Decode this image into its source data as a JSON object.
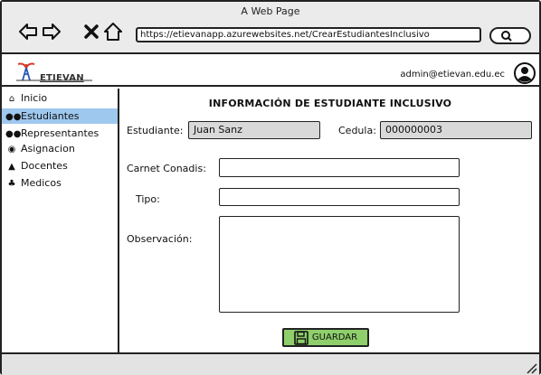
{
  "window": {
    "title": "A Web Page",
    "url": "https://etievanapp.azurewebsites.net/CrearEstudiantesInclusivo"
  },
  "browser_icons": [
    "back-arrow-icon",
    "forward-arrow-icon",
    "close-x-icon",
    "home-icon",
    "search-icon"
  ],
  "header": {
    "brand": "ETIEVAN",
    "user_email": "admin@etievan.edu.ec"
  },
  "sidebar": {
    "items": [
      {
        "label": "Inicio",
        "icon": "home-icon",
        "glyph": "⌂",
        "active": false
      },
      {
        "label": "Estudiantes",
        "icon": "users-icon",
        "glyph": "👥",
        "active": true
      },
      {
        "label": "Representantes",
        "icon": "group-icon",
        "glyph": "👥",
        "active": false
      },
      {
        "label": "Asignacion",
        "icon": "eye-icon",
        "glyph": "◎",
        "active": false
      },
      {
        "label": "Docentes",
        "icon": "teacher-icon",
        "glyph": "▲",
        "active": false
      },
      {
        "label": "Medicos",
        "icon": "doctor-icon",
        "glyph": "♣",
        "active": false
      }
    ]
  },
  "form": {
    "title": "INFORMACIÓN DE ESTUDIANTE INCLUSIVO",
    "estudiante_label": "Estudiante:",
    "estudiante_value": "Juan Sanz",
    "cedula_label": "Cedula:",
    "cedula_value": "000000003",
    "conadis_label": "Carnet Conadis:",
    "conadis_value": "",
    "tipo_label": "Tipo:",
    "tipo_value": "",
    "observacion_label": "Observación:",
    "observacion_value": "",
    "save_label": "GUARDAR"
  },
  "colors": {
    "active_item": "#9fc8ee",
    "save_button": "#8fcf6b",
    "readonly_field": "#d9d9d9",
    "chrome": "#ebebeb"
  }
}
